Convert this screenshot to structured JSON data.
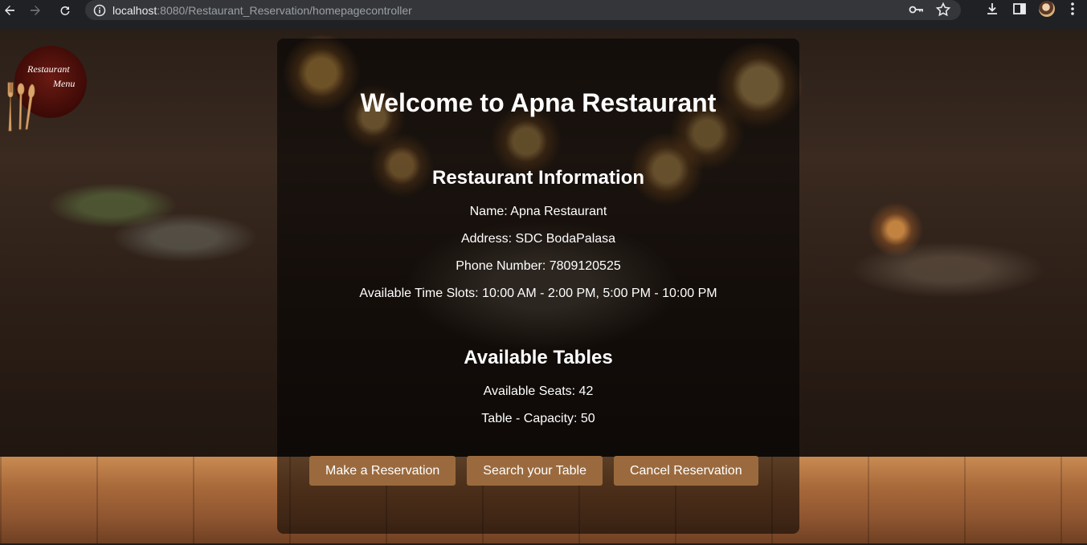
{
  "browser": {
    "url_host": "localhost",
    "url_rest": ":8080/Restaurant_Reservation/homepagecontroller"
  },
  "logo": {
    "line1": "Restaurant",
    "line2": "Menu"
  },
  "card": {
    "title": "Welcome to Apna Restaurant",
    "info_heading": "Restaurant Information",
    "name": "Name: Apna Restaurant",
    "address": "Address: SDC BodaPalasa",
    "phone": "Phone Number: 7809120525",
    "time_slots": "Available Time Slots: 10:00 AM - 2:00 PM, 5:00 PM - 10:00 PM",
    "tables_heading": "Available Tables",
    "seats": "Available Seats: 42",
    "capacity": "Table - Capacity: 50"
  },
  "buttons": {
    "make_reservation": "Make a Reservation",
    "search_table": "Search your Table",
    "cancel_reservation": "Cancel Reservation"
  },
  "colors": {
    "button_bg": "#9a6a3e",
    "card_bg": "rgba(0,0,0,0.55)",
    "logo_bg": "#3d0a06"
  }
}
